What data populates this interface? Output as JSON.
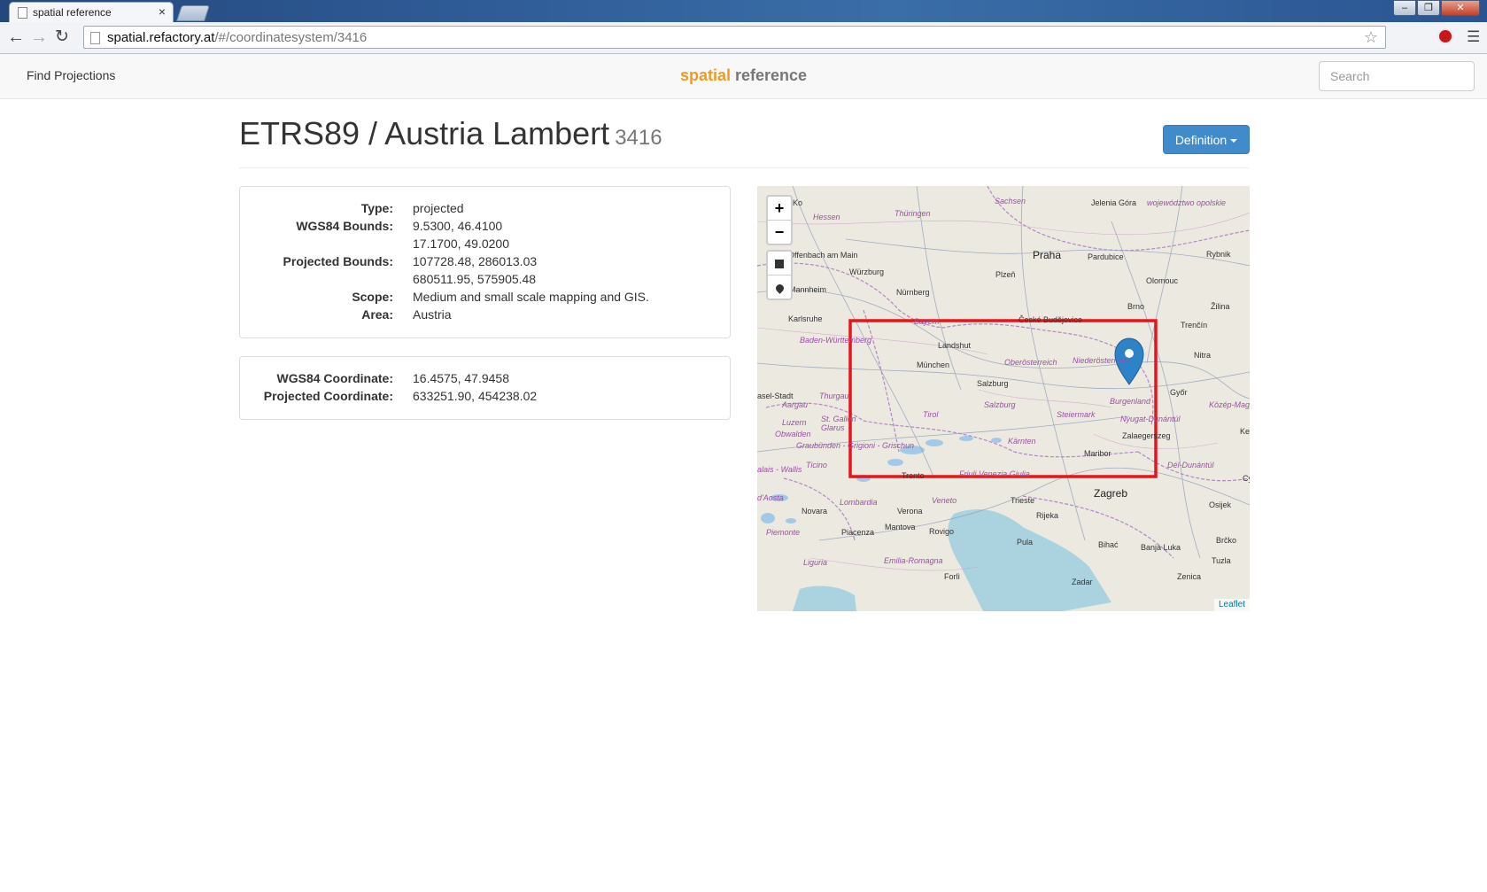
{
  "browser": {
    "tab_title": "spatial reference",
    "tab_close": "×",
    "url_host": "spatial.refactory.at",
    "url_path": "/#/coordinatesystem/3416",
    "back_icon": "arrow-left-icon",
    "forward_icon": "arrow-right-icon",
    "reload_icon": "reload-icon",
    "star_icon": "star-icon",
    "menu_icon": "hamburger-menu-icon"
  },
  "navbar": {
    "find_projections": "Find Projections",
    "brand_part1": "spatial",
    "brand_part2": "reference",
    "search_placeholder": "Search"
  },
  "header": {
    "title": "ETRS89 / Austria Lambert",
    "code": "3416",
    "definition_button": "Definition"
  },
  "info": {
    "type_label": "Type:",
    "type_value": "projected",
    "wgs84_bounds_label": "WGS84 Bounds:",
    "wgs84_bounds_line1": "9.5300, 46.4100",
    "wgs84_bounds_line2": "17.1700, 49.0200",
    "projected_bounds_label": "Projected Bounds:",
    "projected_bounds_line1": "107728.48, 286013.03",
    "projected_bounds_line2": "680511.95, 575905.48",
    "scope_label": "Scope:",
    "scope_value": "Medium and small scale mapping and GIS.",
    "area_label": "Area:",
    "area_value": "Austria"
  },
  "coordinate": {
    "wgs84_label": "WGS84 Coordinate:",
    "wgs84_value": "16.4575, 47.9458",
    "projected_label": "Projected Coordinate:",
    "projected_value": "633251.90, 454238.02"
  },
  "map": {
    "zoom_in": "+",
    "zoom_out": "−",
    "draw_rectangle_icon": "square-icon",
    "marker_tool_icon": "map-marker-icon",
    "attribution": "Leaflet",
    "bounds_color": "#e8141c",
    "marker_color": "#2d83c8",
    "labels": {
      "jelena_gora": "Jelenia Góra",
      "wojewodztwo_opolskie": "województwo opolskie",
      "sachsen": "Sachsen",
      "thuringen": "Thüringen",
      "hessen": "Hessen",
      "offenbach": "Offenbach am Main",
      "wurzburg": "Würzburg",
      "praha": "Praha",
      "pardubice": "Pardubice",
      "rybnik": "Rybnik",
      "mannheim": "Mannheim",
      "nurnberg": "Nürnberg",
      "plzen": "Plzeň",
      "olomouc": "Olomouc",
      "karlsruhe": "Karlsruhe",
      "bayern": "Bayern",
      "ceske_budejovice": "České Budějovice",
      "brno": "Brno",
      "zilina": "Žilina",
      "trencin": "Trenčín",
      "baden_wurttemberg": "Baden-Württemberg",
      "landshut": "Landshut",
      "oberosterreich": "Oberösterreich",
      "niederosterreich": "Niederösterreich",
      "nitra": "Nitra",
      "munchen": "München",
      "salzburg_city": "Salzburg",
      "gyor": "Győr",
      "basel_stadt": "asel-Stadt",
      "thurgau": "Thurgau",
      "aargau": "Aargau",
      "salzburg_region": "Salzburg",
      "burgenland": "Burgenland",
      "kozep_magy": "Közép-Magy",
      "luzern": "Luzern",
      "st_gallen": "St. Gallen",
      "tirol": "Tirol",
      "steiermark": "Steiermark",
      "nyugat_dunantul": "Nyugat-Dunántúl",
      "obwalden": "Obwalden",
      "glarus": "Glarus",
      "graubunden": "Graubünden - Grigioni - Grischun",
      "karnten": "Kärnten",
      "zalaegerszeg": "Zalaegerszeg",
      "maribor": "Maribor",
      "ticino": "Ticino",
      "dal_dunantul": "Dél-Dunántúl",
      "trento": "Trento",
      "friuli": "Friuli Venezia Giulia",
      "valais": "alais - Wallis",
      "zagreb": "Zagreb",
      "aosta": "d'Aosta",
      "lombardia": "Lombardia",
      "veneto": "Veneto",
      "trieste": "Trieste",
      "osijek": "Osijek",
      "novara": "Novara",
      "verona": "Verona",
      "rijeka": "Rijeka",
      "mantova": "Mantova",
      "piacenza": "Piacenza",
      "rovigo": "Rovigo",
      "piemonte": "Piemonte",
      "pula": "Pula",
      "bihac": "Bihać",
      "brcko": "Brčko",
      "banja_luka": "Banja Luka",
      "tuzla": "Tuzla",
      "liguria": "Liguria",
      "emilia_romagna": "Emilia-Romagna",
      "forli": "Forlì",
      "zadar": "Zadar",
      "zenica": "Zenica",
      "ko": "Ko",
      "ke": "Ke",
      "cy": "Cy"
    }
  }
}
